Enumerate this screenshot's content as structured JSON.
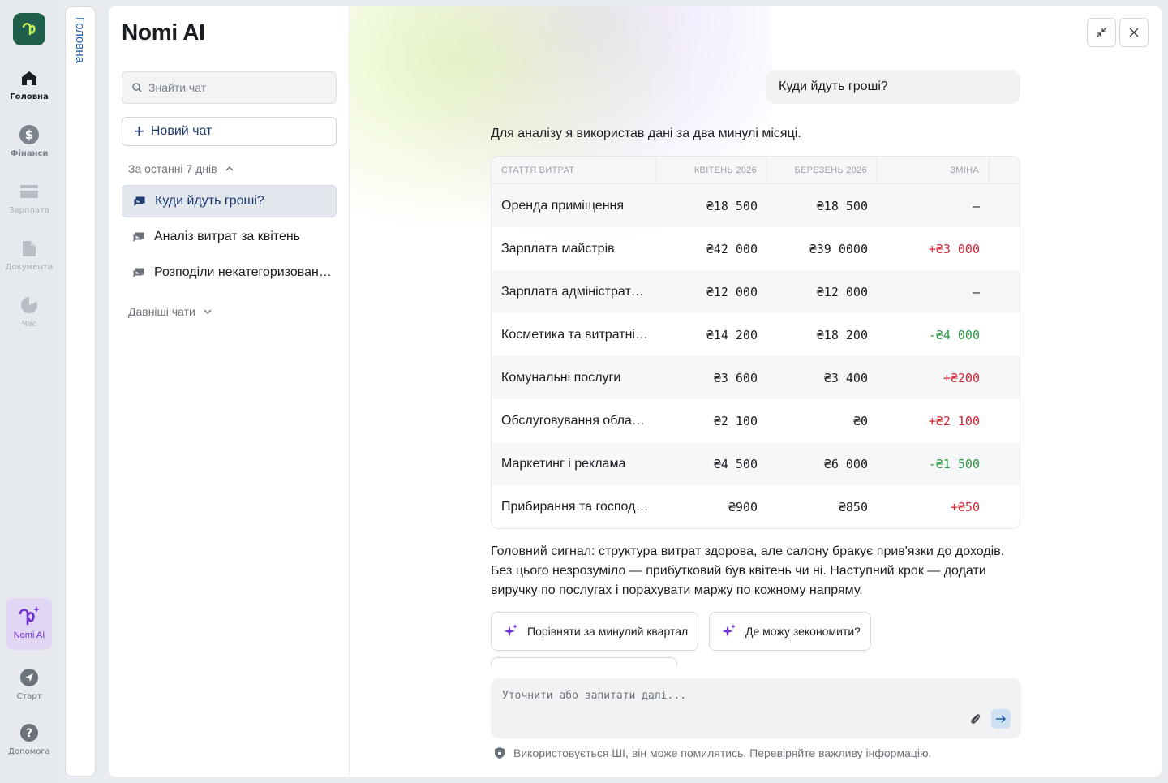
{
  "rail": {
    "items": [
      {
        "label": "Головна",
        "icon": "home-icon"
      },
      {
        "label": "Фінанси",
        "icon": "dollar-icon"
      },
      {
        "label": "Зарплата",
        "icon": "card-icon"
      },
      {
        "label": "Документи",
        "icon": "document-icon"
      },
      {
        "label": "Час",
        "icon": "pie-icon"
      }
    ],
    "ai_label": "Nomi AI",
    "start_label": "Старт",
    "help_label": "Допомога"
  },
  "vertical_tab": {
    "label": "Головна"
  },
  "sidebar": {
    "title": "Nomi AI",
    "search_placeholder": "Знайти чат",
    "new_chat_label": "Новий чат",
    "recent_group": "За останні 7 днів",
    "older_group": "Давніші чати",
    "chats": [
      {
        "title": "Куди йдуть гроші?",
        "selected": true
      },
      {
        "title": "Аналіз витрат за квітень",
        "selected": false
      },
      {
        "title": "Розподіли некатегоризовані транзакції",
        "selected": false
      }
    ]
  },
  "chat": {
    "user_message": "Куди йдуть гроші?",
    "intro": "Для аналізу я використав дані за два минулі місяці.",
    "table": {
      "headers": [
        "Стаття витрат",
        "Квітень 2026",
        "Березень 2026",
        "Зміна"
      ],
      "rows": [
        {
          "item": "Оренда приміщення",
          "apr": "₴18 500",
          "mar": "₴18 500",
          "change": "—",
          "trend": "neu"
        },
        {
          "item": "Зарплата майстрів",
          "apr": "₴42 000",
          "mar": "₴39 0000",
          "change": "+₴3 000",
          "trend": "pos"
        },
        {
          "item": "Зарплата адміністратора",
          "apr": "₴12 000",
          "mar": "₴12 000",
          "change": "—",
          "trend": "neu"
        },
        {
          "item": "Косметика та витратні матеріали",
          "apr": "₴14 200",
          "mar": "₴18 200",
          "change": "-₴4 000",
          "trend": "neg"
        },
        {
          "item": "Комунальні послуги",
          "apr": "₴3 600",
          "mar": "₴3 400",
          "change": "+₴200",
          "trend": "pos"
        },
        {
          "item": "Обслуговування обладнання",
          "apr": "₴2 100",
          "mar": "₴0",
          "change": "+₴2 100",
          "trend": "pos"
        },
        {
          "item": "Маркетинг і реклама",
          "apr": "₴4 500",
          "mar": "₴6 000",
          "change": "-₴1 500",
          "trend": "neg"
        },
        {
          "item": "Прибирання та господарство",
          "apr": "₴900",
          "mar": "₴850",
          "change": "+₴50",
          "trend": "pos"
        }
      ]
    },
    "summary": "Головний сигнал: структура витрат здорова, але салону бракує прив'язки до доходів. Без цього незрозуміло — прибутковий був квітень чи ні. Наступний крок — додати виручку по послугах і порахувати маржу по кожному напряму.",
    "suggestions": [
      "Порівняти за минулий квартал",
      "Де можу зекономити?"
    ],
    "composer_placeholder": "Уточнити або запитати далі...",
    "disclaimer": "Використовується ШІ, він може помилятись. Перевіряйте важливу інформацію."
  },
  "colors": {
    "brand": "#1f5e4a",
    "accent_purple": "#6f2fd1",
    "positive_change": "#d0293a",
    "negative_change": "#2e9a44",
    "link_blue": "#1f3a6e"
  }
}
